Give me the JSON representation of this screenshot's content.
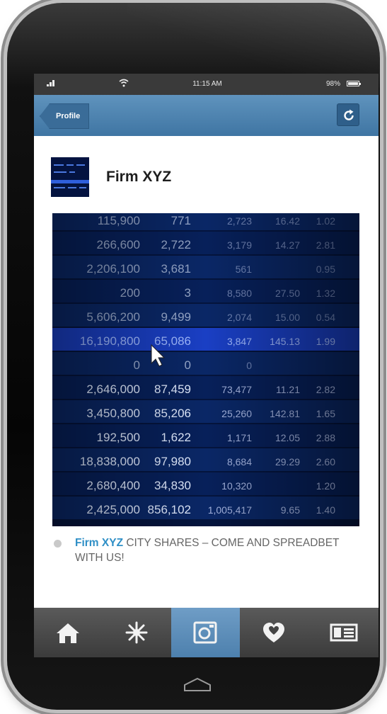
{
  "status_bar": {
    "time": "11:15 AM",
    "battery": "98%",
    "battery_level": 0.98
  },
  "nav": {
    "back_label": "Profile",
    "refresh_icon": "refresh-icon"
  },
  "post": {
    "author": "Firm XYZ",
    "caption_body": " CITY SHARES – COME AND SPREADBET WITH US!"
  },
  "photo_table": {
    "rows": [
      [
        "115,900",
        "771",
        "2,723",
        "16.42",
        "1.02"
      ],
      [
        "266,600",
        "2,722",
        "3,179",
        "14.27",
        "2.81"
      ],
      [
        "2,206,100",
        "3,681",
        "561",
        "",
        "0.95"
      ],
      [
        "200",
        "3",
        "8,580",
        "27.50",
        "1.32"
      ],
      [
        "5,606,200",
        "9,499",
        "2,074",
        "15.00",
        "0.54"
      ],
      [
        "16,190,800",
        "65,086",
        "3,847",
        "145.13",
        "1.99"
      ],
      [
        "0",
        "0",
        "0",
        "",
        ""
      ],
      [
        "2,646,000",
        "87,459",
        "73,477",
        "11.21",
        "2.82"
      ],
      [
        "3,450,800",
        "85,206",
        "25,260",
        "142.81",
        "1.65"
      ],
      [
        "192,500",
        "1,622",
        "1,171",
        "12.05",
        "2.88"
      ],
      [
        "18,838,000",
        "97,980",
        "8,684",
        "29.29",
        "2.60"
      ],
      [
        "2,680,400",
        "34,830",
        "10,320",
        "",
        "1.20"
      ],
      [
        "2,425,000",
        "856,102",
        "1,005,417",
        "9.65",
        "1.40"
      ]
    ],
    "highlight_row": 5
  },
  "tabs": [
    {
      "name": "home",
      "icon": "home-icon",
      "active": false
    },
    {
      "name": "explore",
      "icon": "star-icon",
      "active": false
    },
    {
      "name": "camera",
      "icon": "camera-icon",
      "active": true
    },
    {
      "name": "favorites",
      "icon": "heart-icon",
      "active": false
    },
    {
      "name": "profile",
      "icon": "profile-card-icon",
      "active": false
    }
  ],
  "colors": {
    "navbar": "#4f85b2",
    "accent": "#2f8fc6",
    "tab_active": "#5d8fbc"
  }
}
